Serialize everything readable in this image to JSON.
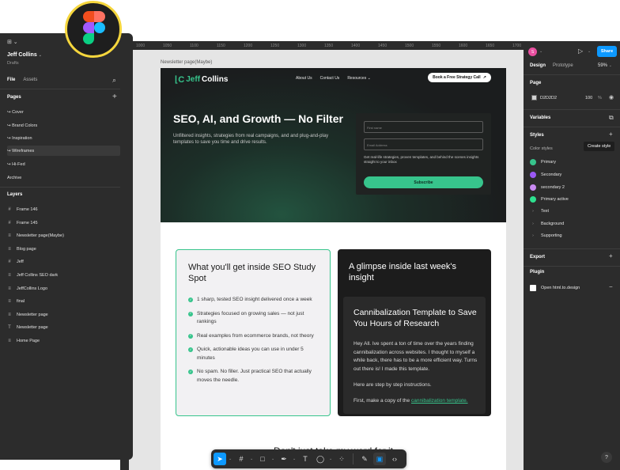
{
  "left_panel": {
    "menu_icon": "figma-menu-icon",
    "project_name": "Jeff Collins",
    "project_location": "Drafts",
    "tabs": [
      "File",
      "Assets"
    ],
    "pages_title": "Pages",
    "pages": [
      "Cover",
      "Brand Colors",
      "Inspiration",
      "Wireframes",
      "Hi-Fed",
      "Archive"
    ],
    "layers_title": "Layers",
    "layers": [
      {
        "icon": "#",
        "label": "Frame 146"
      },
      {
        "icon": "#",
        "label": "Frame 145"
      },
      {
        "icon": "≡",
        "label": "Newsletter page(Maybe)"
      },
      {
        "icon": "≡",
        "label": "Blog page"
      },
      {
        "icon": "#",
        "label": "Jeff"
      },
      {
        "icon": "≡",
        "label": "Jeff Collins SEO dark"
      },
      {
        "icon": "≡",
        "label": "JeffCollins Logo"
      },
      {
        "icon": "≡",
        "label": "final"
      },
      {
        "icon": "≡",
        "label": "Newsletter page"
      },
      {
        "icon": "T",
        "label": "Newsletter page"
      },
      {
        "icon": "≡",
        "label": "Home Page"
      }
    ]
  },
  "canvas": {
    "ruler_top": [
      "1000",
      "1050",
      "1100",
      "1150",
      "1200",
      "1250",
      "1300",
      "1350",
      "1400",
      "1450",
      "1500",
      "1550",
      "1600",
      "1650",
      "1700"
    ],
    "ruler_left": [
      "800",
      "850",
      "900",
      "950",
      "1000",
      "1050",
      "1100",
      "1150",
      "1200",
      "1250",
      "1300",
      "1350",
      "1400"
    ],
    "frame_label": "Newsletter page(Maybe)",
    "frame": {
      "logo_text": "JeffCollins",
      "logo_part1": "Jeff",
      "logo_part2": "Collins",
      "nav_links": [
        "About Us",
        "Contact Us",
        "Resources"
      ],
      "cta": "Book a Free Strategy Call",
      "hero_title": "SEO, AI, and Growth — No Filter",
      "hero_sub": "Unfiltered insights, strategies from real campaigns, and and plug-and-play templates to save you time and drive results.",
      "input1_placeholder": "First name",
      "input2_placeholder": "Email Address",
      "form_text": "Get real-life strategies, proven templates, and behind the scenes insights straight to your inbox",
      "subscribe": "Subscribe",
      "left_card_title": "What you'll get inside SEO Study Spot",
      "bullets": [
        "1 sharp, tested SEO insight delivered once a week",
        "Strategies focused on growing sales — not just rankings",
        "Real examples from ecommerce brands, not theory",
        "Quick, actionable ideas you can use in under 5 minutes",
        "No spam. No filler. Just practical SEO that actually moves the needle."
      ],
      "right_card_title": "A glimpse inside last week's insight",
      "inner_title": "Cannibalization Template to Save You Hours of Research",
      "inner_p1": "Hey All. Ive spent a ton of time over the years finding cannibalization across websites. I thought to myself a while back, there has to be a more efficient way. Turns out there is! I made this template.",
      "inner_p2": "Here are step by step instructions.",
      "inner_p3_prefix": "First, make a copy of the ",
      "inner_p3_link": "cannibalization template.",
      "bottom_heading": "Don't just take my word for it"
    }
  },
  "toolbar": {
    "tools": [
      "move-tool",
      "frame-tool",
      "shape-tool",
      "pen-tool",
      "text-tool",
      "comment-tool",
      "actions-tool",
      "draw-mode",
      "design-mode",
      "dev-mode"
    ]
  },
  "right_panel": {
    "avatar_letter": "S",
    "share": "Share",
    "tabs": [
      "Design",
      "Prototype"
    ],
    "zoom": "59%",
    "page_title": "Page",
    "page_color": "D2D2D2",
    "page_opacity": "100",
    "page_pct": "%",
    "variables": "Variables",
    "styles": "Styles",
    "color_styles": "Color styles",
    "tooltip": "Create style",
    "colors": [
      {
        "name": "Primary",
        "hex": "#37c48c"
      },
      {
        "name": "Secondary",
        "hex": "#9b59f5"
      },
      {
        "name": "secondary 2",
        "hex": "#c98af2"
      },
      {
        "name": "Primary active",
        "hex": "#2ee08f"
      }
    ],
    "text_styles": [
      "Text",
      "Background",
      "Supporting"
    ],
    "export": "Export",
    "plugin": "Plugin",
    "plugin_name": "Open html.to.design",
    "help": "?"
  },
  "colors": {
    "accent": "#0d99ff",
    "brand_green": "#37c48c",
    "panel": "#2c2c2c"
  }
}
